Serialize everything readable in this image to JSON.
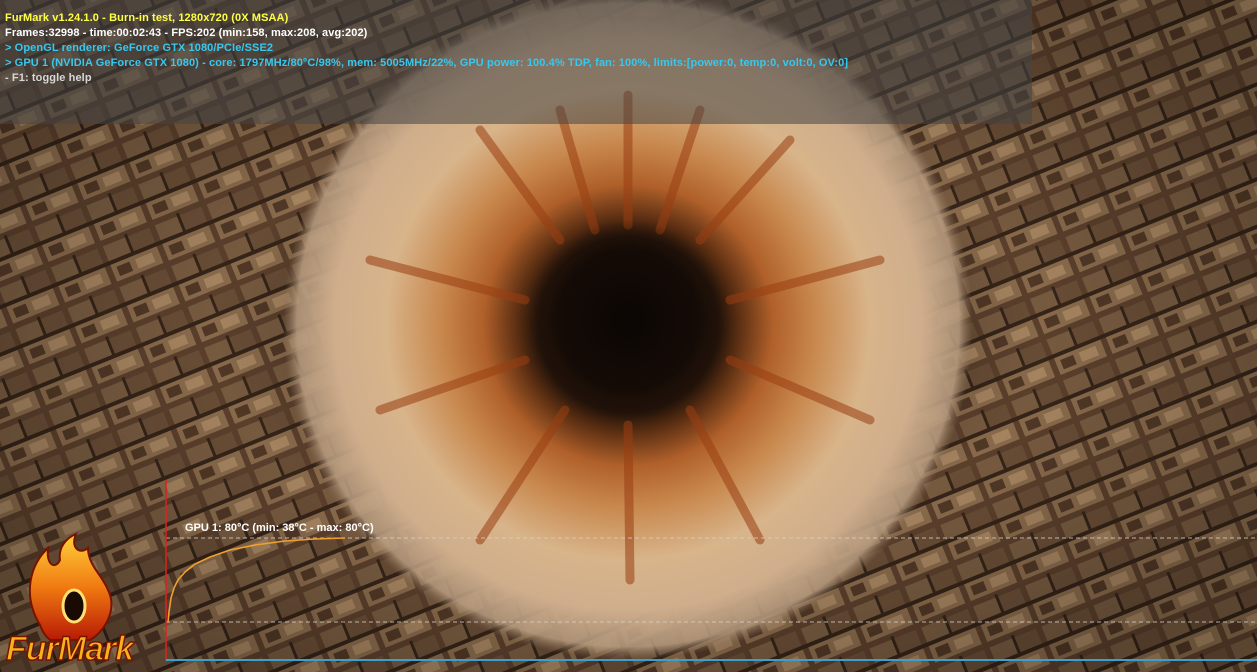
{
  "hud": {
    "title": "FurMark v1.24.1.0 - Burn-in test, 1280x720 (0X MSAA)",
    "stats": "Frames:32998 - time:00:02:43 - FPS:202 (min:158, max:208, avg:202)",
    "renderer": "> OpenGL renderer: GeForce GTX 1080/PCIe/SSE2",
    "gpu_info": "> GPU 1 (NVIDIA GeForce GTX 1080) - core: 1797MHz/80°C/98%, mem: 5005MHz/22%, GPU power: 100.4% TDP, fan: 100%, limits:[power:0, temp:0, volt:0, OV:0]",
    "help": "- F1: toggle help"
  },
  "temperature_graph": {
    "label": "GPU 1: 80°C (min: 38°C - max: 80°C)",
    "current_c": 80,
    "min_c": 38,
    "max_c": 80
  },
  "logo": {
    "text": "FurMark"
  },
  "colors": {
    "title": "#ffff44",
    "stats": "#ffffff",
    "info": "#37c8f0",
    "help": "#d8d8d8",
    "curve": "#f0a030",
    "axis": "#e02020",
    "baseline": "#3aa0d0"
  }
}
